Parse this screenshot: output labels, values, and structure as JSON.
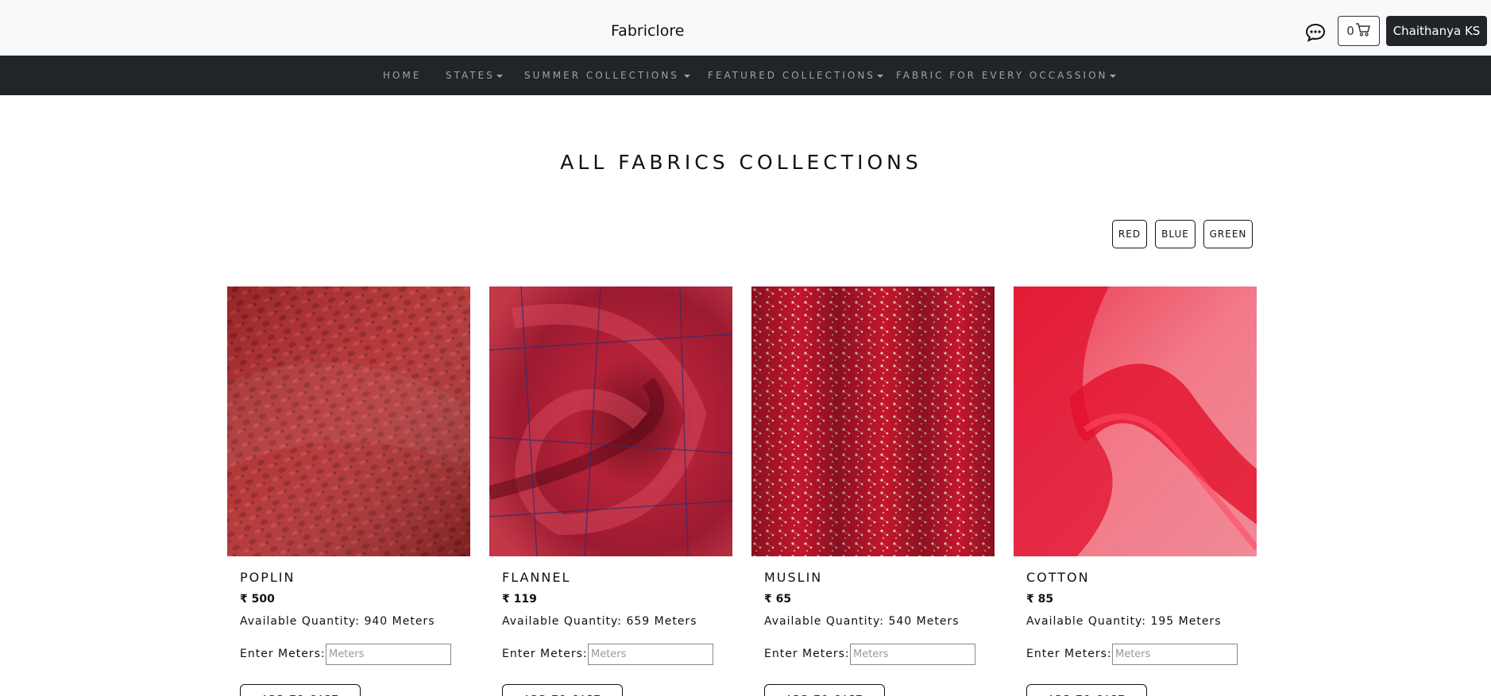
{
  "header": {
    "brand": "Fabriclore",
    "cart_count": "0",
    "user_name": "Chaithanya KS",
    "icons": [
      "chat-icon",
      "cart-icon"
    ]
  },
  "nav": {
    "items": [
      {
        "label": "HOME",
        "dropdown": false
      },
      {
        "label": "STATES",
        "dropdown": true
      },
      {
        "label": "SUMMER COLLECTIONS",
        "dropdown": true
      },
      {
        "label": "FEATURED COLLECTIONS",
        "dropdown": true
      },
      {
        "label": "FABRIC FOR EVERY OCCASSION",
        "dropdown": true
      }
    ]
  },
  "main": {
    "title": "ALL FABRICS COLLECTIONS",
    "filters": [
      "RED",
      "BLUE",
      "GREEN"
    ],
    "products": [
      {
        "name": "POPLIN",
        "price": "₹ 500",
        "quantity": "Available Quantity: 940 Meters",
        "meter_label": "Enter Meters:",
        "meter_placeholder": "Meters",
        "add_label": "ADD TO CART"
      },
      {
        "name": "FLANNEL",
        "price": "₹ 119",
        "quantity": "Available Quantity: 659 Meters",
        "meter_label": "Enter Meters:",
        "meter_placeholder": "Meters",
        "add_label": "ADD TO CART"
      },
      {
        "name": "MUSLIN",
        "price": "₹ 65",
        "quantity": "Available Quantity: 540 Meters",
        "meter_label": "Enter Meters:",
        "meter_placeholder": "Meters",
        "add_label": "ADD TO CART"
      },
      {
        "name": "COTTON",
        "price": "₹ 85",
        "quantity": "Available Quantity: 195 Meters",
        "meter_label": "Enter Meters:",
        "meter_placeholder": "Meters",
        "add_label": "ADD TO CART"
      }
    ]
  },
  "colors": {
    "navbar_bg": "#212529",
    "topbar_bg": "#f8f9fb",
    "nav_text": "#9ea3a8",
    "poplin_fabric": "#b3262b",
    "flannel_fabric": "#a81c35",
    "muslin_fabric": "#c4162e",
    "cotton_fabric": "#e8203e"
  }
}
